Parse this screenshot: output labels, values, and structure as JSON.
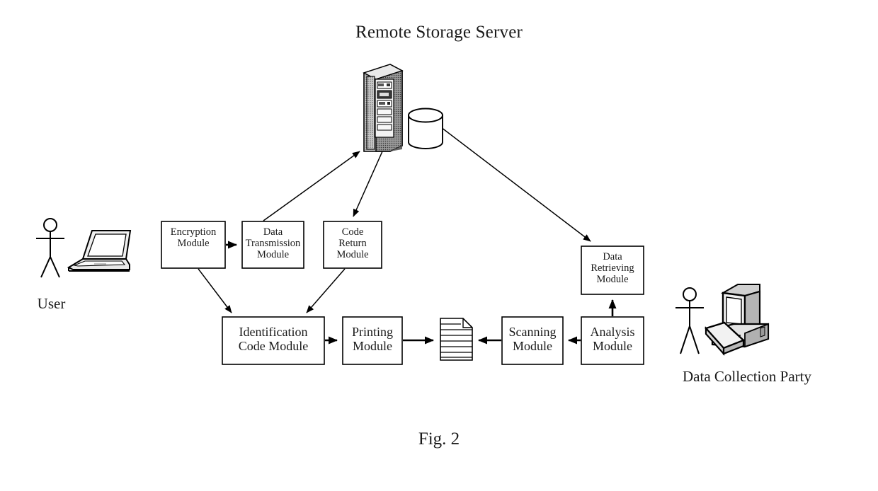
{
  "figure": {
    "title": "Remote Storage Server",
    "caption": "Fig. 2"
  },
  "actors": [
    {
      "id": "user",
      "label": "User",
      "icon": "stick-figure-with-laptop-icon"
    },
    {
      "id": "data-collection-party",
      "label": "Data Collection Party",
      "icon": "stick-figure-with-desktop-computer-icon"
    }
  ],
  "server": {
    "tower_icon": "server-tower-icon",
    "database_icon": "database-cylinder-icon"
  },
  "document": {
    "icon": "printed-document-icon",
    "line_count": 7
  },
  "boxes": [
    {
      "id": "encryption-module",
      "label": "Encryption\nModule"
    },
    {
      "id": "data-transmission-module",
      "label": "Data\nTransmission\nModule"
    },
    {
      "id": "code-return-module",
      "label": "Code\nReturn\nModule"
    },
    {
      "id": "data-retrieving-module",
      "label": "Data\nRetrieving\nModule"
    },
    {
      "id": "identification-code-module",
      "label": "Identification\nCode Module"
    },
    {
      "id": "printing-module",
      "label": "Printing\nModule"
    },
    {
      "id": "scanning-module",
      "label": "Scanning\nModule"
    },
    {
      "id": "analysis-module",
      "label": "Analysis\nModule"
    }
  ],
  "connections": [
    {
      "from": "encryption-module",
      "to": "data-transmission-module",
      "style": "horizontal-arrow"
    },
    {
      "from": "data-transmission-module",
      "to": "server",
      "style": "diagonal-arrow"
    },
    {
      "from": "server",
      "to": "code-return-module",
      "style": "diagonal-arrow"
    },
    {
      "from": "encryption-module",
      "to": "identification-code-module",
      "style": "diagonal-arrow"
    },
    {
      "from": "code-return-module",
      "to": "identification-code-module",
      "style": "diagonal-arrow"
    },
    {
      "from": "identification-code-module",
      "to": "printing-module",
      "style": "horizontal-arrow"
    },
    {
      "from": "printing-module",
      "to": "document",
      "style": "horizontal-arrow"
    },
    {
      "from": "scanning-module",
      "to": "document",
      "style": "horizontal-arrow"
    },
    {
      "from": "analysis-module",
      "to": "scanning-module",
      "style": "horizontal-arrow"
    },
    {
      "from": "analysis-module",
      "to": "data-retrieving-module",
      "style": "vertical-arrow"
    },
    {
      "from": "database",
      "to": "data-retrieving-module",
      "style": "diagonal-arrow"
    }
  ],
  "colors": {
    "stroke": "#000000",
    "fill": "#ffffff",
    "text": "#1a1a1a",
    "shade_light": "#d9d9d9",
    "shade_mid": "#bfbfbf",
    "shade_dark": "#8c8c8c"
  }
}
